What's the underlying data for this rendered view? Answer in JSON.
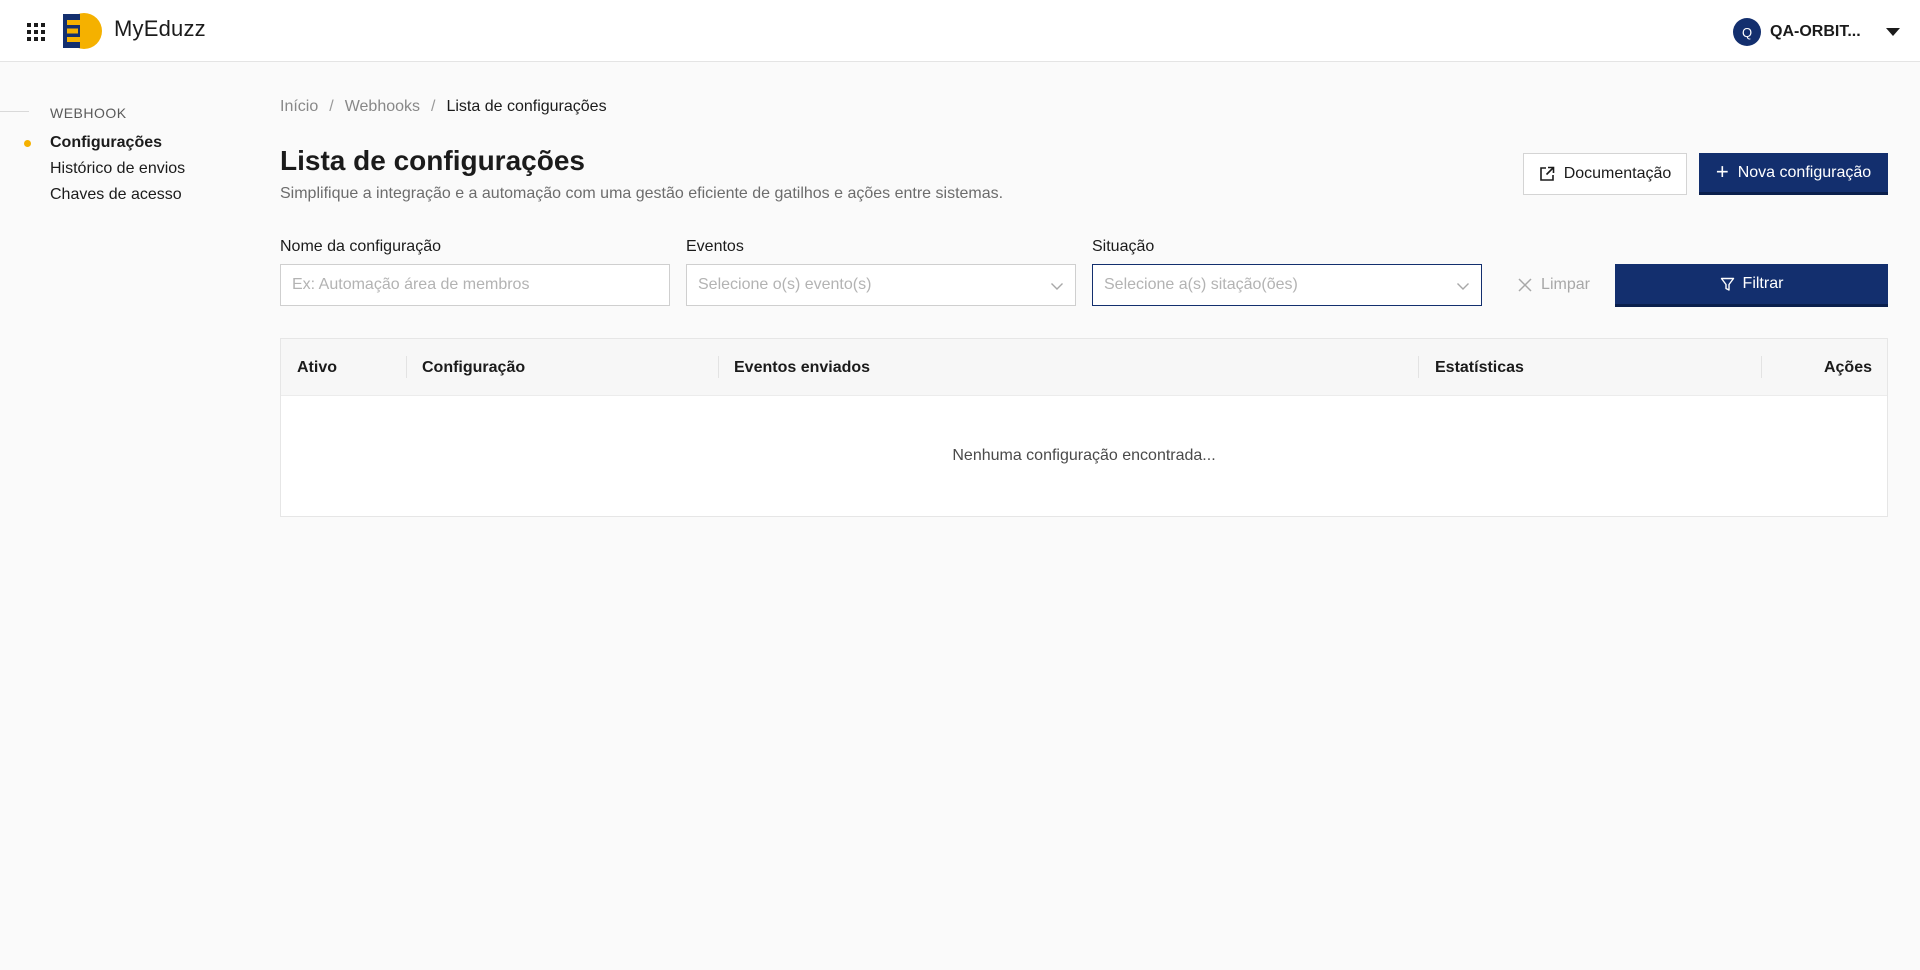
{
  "header": {
    "brand": "MyEduzz",
    "account": {
      "initial": "Q",
      "name": "QA-ORBIT..."
    }
  },
  "sidebar": {
    "heading": "WEBHOOK",
    "items": [
      {
        "label": "Configurações",
        "active": true
      },
      {
        "label": "Histórico de envios",
        "active": false
      },
      {
        "label": "Chaves de acesso",
        "active": false
      }
    ]
  },
  "breadcrumb": [
    "Início",
    "Webhooks",
    "Lista de configurações"
  ],
  "page": {
    "title": "Lista de configurações",
    "subtitle": "Simplifique a integração e a automação com uma gestão eficiente de gatilhos e ações entre sistemas."
  },
  "actions": {
    "documentation": "Documentação",
    "new_config": "Nova configuração"
  },
  "filters": {
    "name": {
      "label": "Nome da configuração",
      "placeholder": "Ex: Automação área de membros",
      "value": ""
    },
    "events": {
      "label": "Eventos",
      "placeholder": "Selecione o(s) evento(s)"
    },
    "status": {
      "label": "Situação",
      "placeholder": "Selecione a(s) sitação(ões)"
    },
    "clear": "Limpar",
    "filter": "Filtrar"
  },
  "table": {
    "columns": [
      "Ativo",
      "Configuração",
      "Eventos enviados",
      "Estatísticas",
      "Ações"
    ],
    "rows": [],
    "empty_message": "Nenhuma configuração encontrada..."
  },
  "colors": {
    "primary": "#132f6e",
    "accent": "#f5b100",
    "background": "#fafafa"
  }
}
